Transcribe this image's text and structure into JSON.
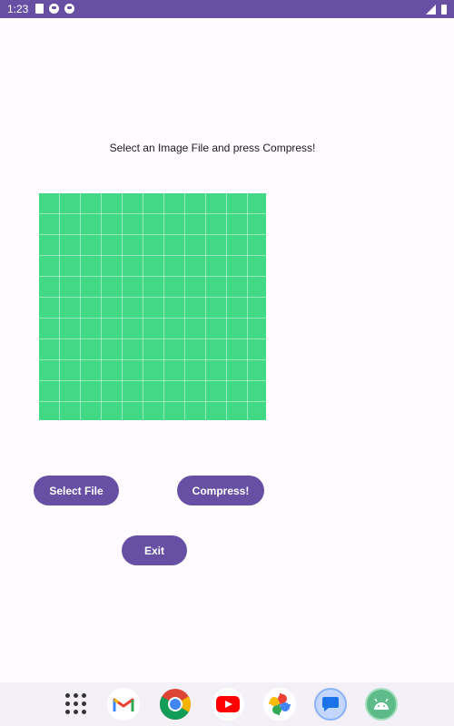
{
  "status_bar": {
    "time": "1:23",
    "icons": [
      "sd-card-icon",
      "notification-icon",
      "notification-icon"
    ],
    "right_icons": [
      "signal-icon",
      "battery-icon"
    ],
    "color": "#6750a4"
  },
  "main": {
    "instruction": "Select an Image File and press Compress!",
    "image_color": "#41d985"
  },
  "buttons": {
    "select_file": "Select File",
    "compress": "Compress!",
    "exit": "Exit",
    "color": "#6750a4"
  },
  "dock": {
    "apps": [
      "app-drawer",
      "gmail",
      "chrome",
      "youtube",
      "photos",
      "messages",
      "android"
    ]
  }
}
